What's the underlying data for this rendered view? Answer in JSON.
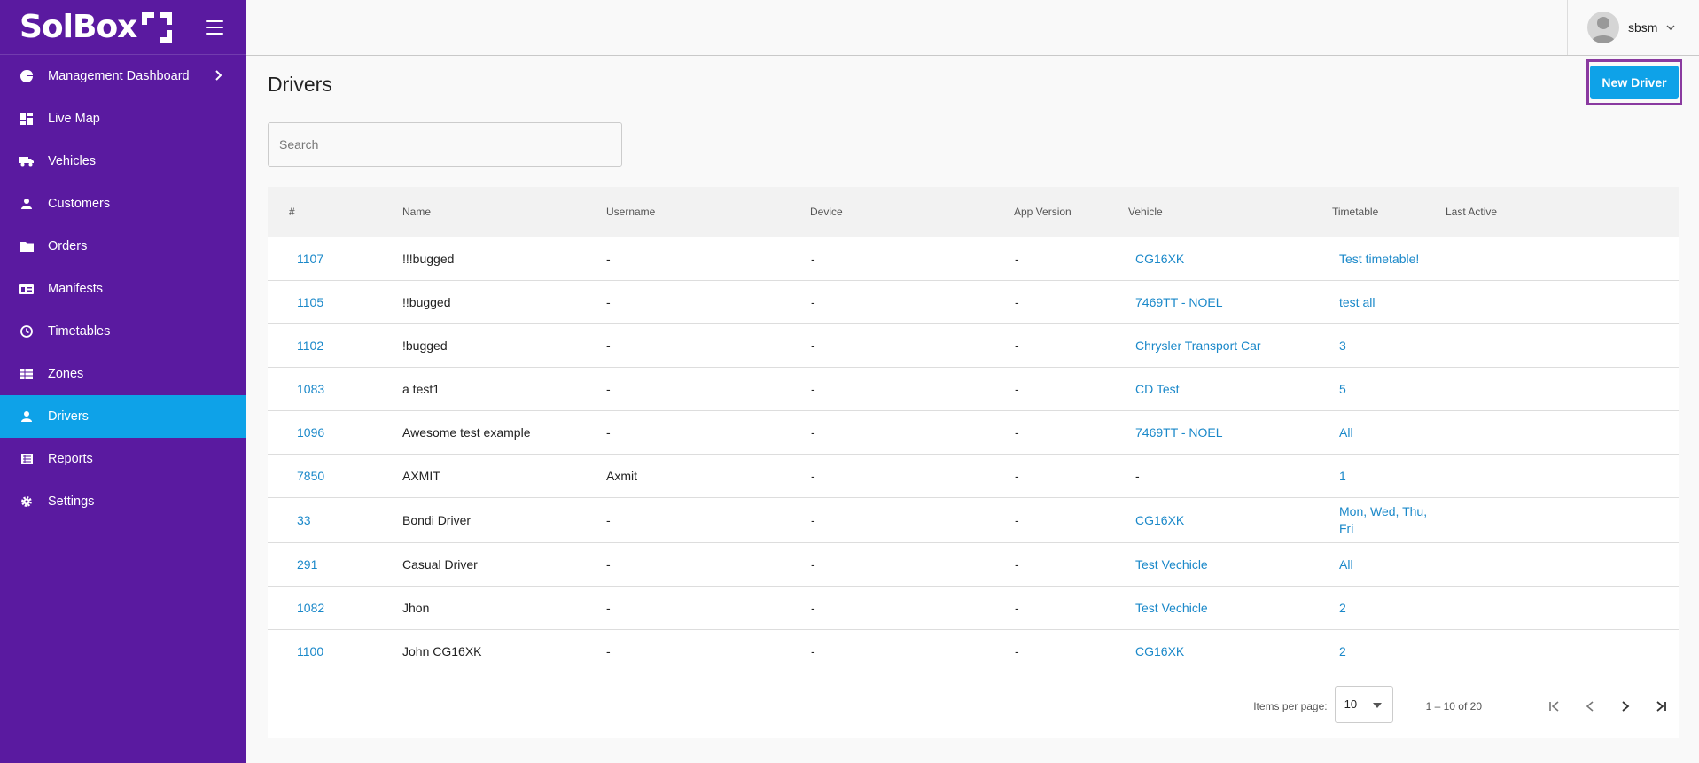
{
  "brand": {
    "logo": "SolBox"
  },
  "sidebar": {
    "items": [
      {
        "label": "Management Dashboard",
        "icon": "pie-chart-icon"
      },
      {
        "label": "Live Map",
        "icon": "dashboard-icon"
      },
      {
        "label": "Vehicles",
        "icon": "truck-icon"
      },
      {
        "label": "Customers",
        "icon": "person-icon"
      },
      {
        "label": "Orders",
        "icon": "folder-icon"
      },
      {
        "label": "Manifests",
        "icon": "manifest-icon"
      },
      {
        "label": "Timetables",
        "icon": "clock-icon"
      },
      {
        "label": "Zones",
        "icon": "grid-icon"
      },
      {
        "label": "Drivers",
        "icon": "person-icon",
        "active": true
      },
      {
        "label": "Reports",
        "icon": "list-icon"
      },
      {
        "label": "Settings",
        "icon": "gear-icon"
      }
    ]
  },
  "topbar": {
    "user_name": "sbsm"
  },
  "page": {
    "title": "Drivers",
    "new_button": "New Driver",
    "search_placeholder": "Search"
  },
  "table": {
    "headers": [
      "#",
      "Name",
      "Username",
      "Device",
      "App Version",
      "Vehicle",
      "Timetable",
      "Last Active"
    ],
    "rows": [
      {
        "id": "1107",
        "name": "!!!bugged",
        "username": "-",
        "device": "-",
        "app_version": "-",
        "vehicle": "CG16XK",
        "timetable": "Test timetable!",
        "last_active": ""
      },
      {
        "id": "1105",
        "name": "!!bugged",
        "username": "-",
        "device": "-",
        "app_version": "-",
        "vehicle": "7469TT - NOEL",
        "timetable": "test all",
        "last_active": ""
      },
      {
        "id": "1102",
        "name": "!bugged",
        "username": "-",
        "device": "-",
        "app_version": "-",
        "vehicle": "Chrysler Transport Car",
        "timetable": "3",
        "last_active": ""
      },
      {
        "id": "1083",
        "name": "a test1",
        "username": "-",
        "device": "-",
        "app_version": "-",
        "vehicle": "CD Test",
        "timetable": "5",
        "last_active": ""
      },
      {
        "id": "1096",
        "name": "Awesome test example",
        "username": "-",
        "device": "-",
        "app_version": "-",
        "vehicle": "7469TT - NOEL",
        "timetable": "All",
        "last_active": ""
      },
      {
        "id": "7850",
        "name": "AXMIT",
        "username": "Axmit",
        "device": "-",
        "app_version": "-",
        "vehicle": "-",
        "timetable": "1",
        "last_active": ""
      },
      {
        "id": "33",
        "name": "Bondi Driver",
        "username": "-",
        "device": "-",
        "app_version": "-",
        "vehicle": "CG16XK",
        "timetable_lines": [
          "Mon, Wed, Thu,",
          "Fri"
        ],
        "last_active": ""
      },
      {
        "id": "291",
        "name": "Casual Driver",
        "username": "-",
        "device": "-",
        "app_version": "-",
        "vehicle": "Test Vechicle",
        "timetable": "All",
        "last_active": ""
      },
      {
        "id": "1082",
        "name": "Jhon",
        "username": "-",
        "device": "-",
        "app_version": "-",
        "vehicle": "Test Vechicle",
        "timetable": "2",
        "last_active": ""
      },
      {
        "id": "1100",
        "name": "John CG16XK",
        "username": "-",
        "device": "-",
        "app_version": "-",
        "vehicle": "CG16XK",
        "timetable": "2",
        "last_active": ""
      }
    ]
  },
  "paginator": {
    "items_per_page_label": "Items per page:",
    "items_per_page": "10",
    "range": "1 – 10 of 20"
  },
  "colors": {
    "sidebar": "#5a1aa0",
    "accent": "#0ea2e8",
    "link": "#1a88c9",
    "highlight_border": "#8a3aa0"
  }
}
